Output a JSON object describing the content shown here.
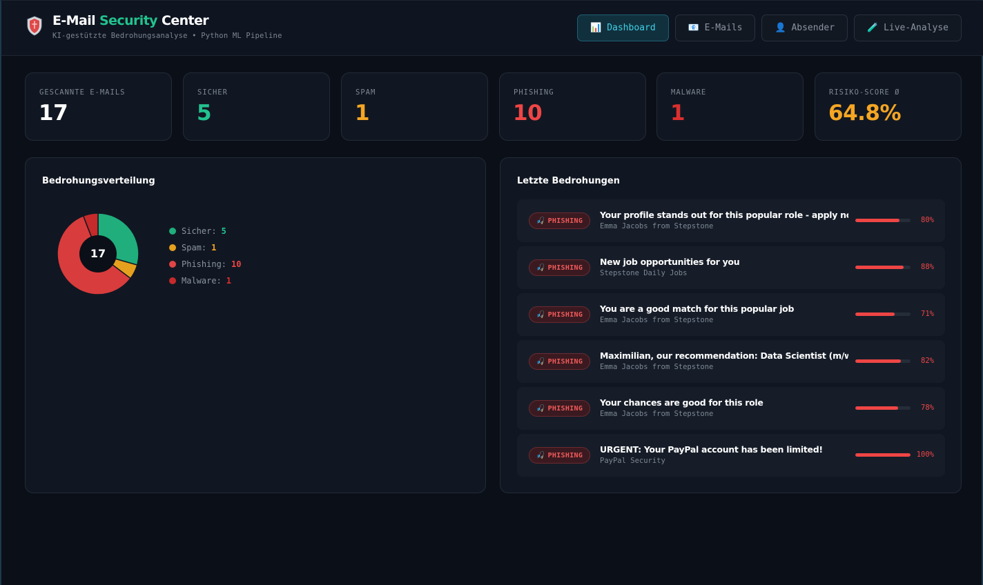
{
  "header": {
    "title_part1": "E-Mail",
    "title_accent": "Security",
    "title_part2": "Center",
    "subtitle": "KI-gestützte Bedrohungsanalyse • Python ML Pipeline",
    "logo_icon": "shield-icon",
    "nav": [
      {
        "label": "Dashboard",
        "icon": "📊",
        "icon_name": "chart-icon",
        "active": true
      },
      {
        "label": "E-Mails",
        "icon": "📧",
        "icon_name": "email-icon",
        "active": false
      },
      {
        "label": "Absender",
        "icon": "👤",
        "icon_name": "user-icon",
        "active": false
      },
      {
        "label": "Live-Analyse",
        "icon": "🧪",
        "icon_name": "test-tube-icon",
        "active": false
      }
    ]
  },
  "stats": [
    {
      "label": "GESCANNTE E-MAILS",
      "value": "17",
      "color": "#ffffff"
    },
    {
      "label": "SICHER",
      "value": "5",
      "color": "#22c38e"
    },
    {
      "label": "SPAM",
      "value": "1",
      "color": "#f5a623"
    },
    {
      "label": "PHISHING",
      "value": "10",
      "color": "#ef4545"
    },
    {
      "label": "MALWARE",
      "value": "1",
      "color": "#dc2f2f"
    },
    {
      "label": "RISIKO-SCORE Ø",
      "value": "64.8%",
      "color": "#f5a623"
    }
  ],
  "distribution": {
    "title": "Bedrohungsverteilung",
    "total": "17",
    "items": [
      {
        "label": "Sicher:",
        "value": "5",
        "count": 5,
        "color": "#1fae7c"
      },
      {
        "label": "Spam:",
        "value": "1",
        "count": 1,
        "color": "#e5a01e"
      },
      {
        "label": "Phishing:",
        "value": "10",
        "count": 10,
        "color": "#d93c3c"
      },
      {
        "label": "Malware:",
        "value": "1",
        "count": 1,
        "color": "#c62a2a"
      }
    ]
  },
  "threats": {
    "title": "Letzte Bedrohungen",
    "items": [
      {
        "badge": "PHISHING",
        "subject": "Your profile stands out for this popular role - apply now!",
        "sender": "Emma Jacobs from Stepstone",
        "risk": 0.8,
        "pct": "80%"
      },
      {
        "badge": "PHISHING",
        "subject": "New job opportunities for you",
        "sender": "Stepstone Daily Jobs",
        "risk": 0.88,
        "pct": "88%"
      },
      {
        "badge": "PHISHING",
        "subject": "You are a good match for this popular job",
        "sender": "Emma Jacobs from Stepstone",
        "risk": 0.71,
        "pct": "71%"
      },
      {
        "badge": "PHISHING",
        "subject": "Maximilian, our recommendation: Data Scientist (m/w/d)",
        "sender": "Emma Jacobs from Stepstone",
        "risk": 0.82,
        "pct": "82%"
      },
      {
        "badge": "PHISHING",
        "subject": "Your chances are good for this role",
        "sender": "Emma Jacobs from Stepstone",
        "risk": 0.78,
        "pct": "78%"
      },
      {
        "badge": "PHISHING",
        "subject": "URGENT: Your PayPal account has been limited!",
        "sender": "PayPal Security",
        "risk": 1.0,
        "pct": "100%"
      }
    ]
  }
}
